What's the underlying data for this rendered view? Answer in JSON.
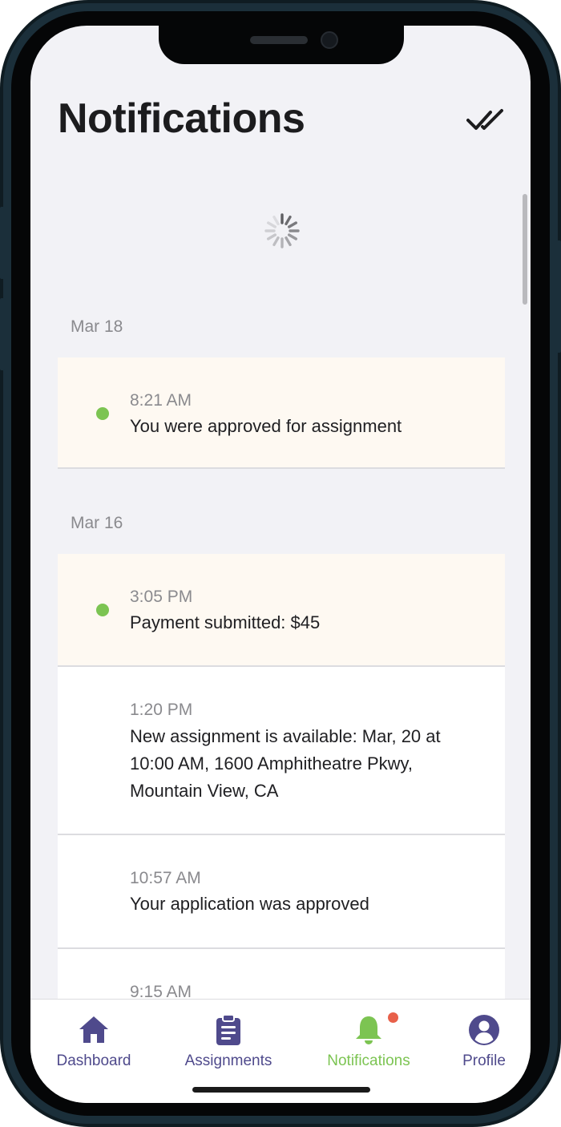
{
  "header": {
    "title": "Notifications",
    "mark_all_read_icon": "double-check-icon"
  },
  "notifications": {
    "groups": [
      {
        "date": "Mar 18",
        "items": [
          {
            "time": "8:21 AM",
            "message": "You were approved for assignment",
            "unread": true
          }
        ]
      },
      {
        "date": "Mar 16",
        "items": [
          {
            "time": "3:05 PM",
            "message": "Payment submitted: $45",
            "unread": true
          },
          {
            "time": "1:20 PM",
            "message": "New assignment is available: Mar, 20 at 10:00 AM, 1600 Amphitheatre Pkwy, Mountain View, CA",
            "unread": false
          },
          {
            "time": "10:57 AM",
            "message": "Your application was approved",
            "unread": false
          },
          {
            "time": "9:15 AM",
            "message": "",
            "unread": false
          }
        ]
      }
    ]
  },
  "tabbar": {
    "tabs": [
      {
        "label": "Dashboard",
        "icon": "home-icon",
        "active": false
      },
      {
        "label": "Assignments",
        "icon": "clipboard-icon",
        "active": false
      },
      {
        "label": "Notifications",
        "icon": "bell-icon",
        "active": true,
        "badge": true
      },
      {
        "label": "Profile",
        "icon": "user-circle-icon",
        "active": false
      }
    ]
  },
  "colors": {
    "accent_purple": "#4f4a8c",
    "accent_green": "#7cc452",
    "unread_background": "#fef9f2",
    "badge_red": "#e8604a",
    "screen_background": "#f2f2f6"
  }
}
